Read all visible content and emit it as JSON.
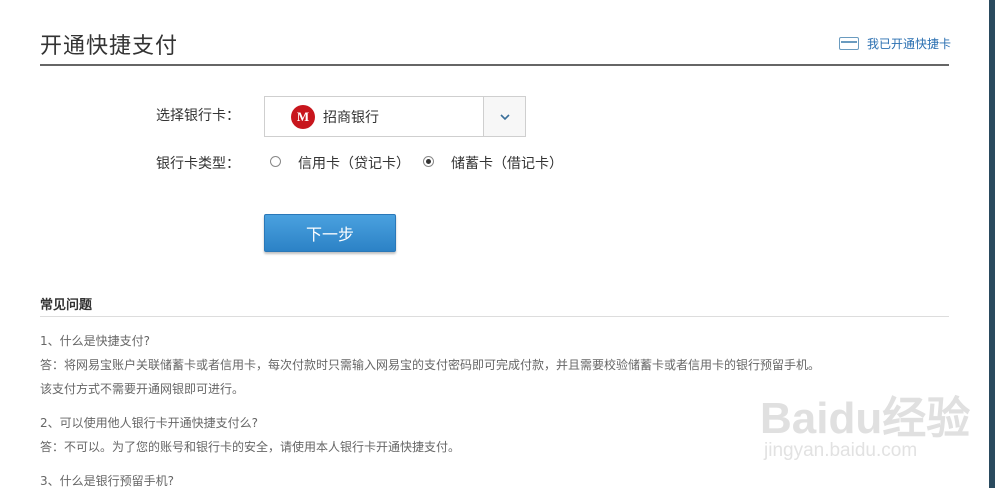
{
  "header": {
    "title": "开通快捷支付",
    "opened_link": "我已开通快捷卡"
  },
  "form": {
    "bank_label": "选择银行卡：",
    "bank_selected": "招商银行",
    "card_type_label": "银行卡类型：",
    "card_types": [
      {
        "label": "信用卡（贷记卡）",
        "checked": false
      },
      {
        "label": "储蓄卡（借记卡）",
        "checked": true
      }
    ],
    "next_button": "下一步"
  },
  "faq": {
    "title": "常见问题",
    "lines": [
      "1、什么是快捷支付?",
      "答：将网易宝账户关联储蓄卡或者信用卡，每次付款时只需输入网易宝的支付密码即可完成付款，并且需要校验储蓄卡或者信用卡的银行预留手机。",
      "该支付方式不需要开通网银即可进行。",
      "2、可以使用他人银行卡开通快捷支付么?",
      "答：不可以。为了您的账号和银行卡的安全，请使用本人银行卡开通快捷支付。",
      "3、什么是银行预留手机?"
    ]
  },
  "watermark": {
    "main": "Baidu经验",
    "sub": "jingyan.baidu.com"
  }
}
